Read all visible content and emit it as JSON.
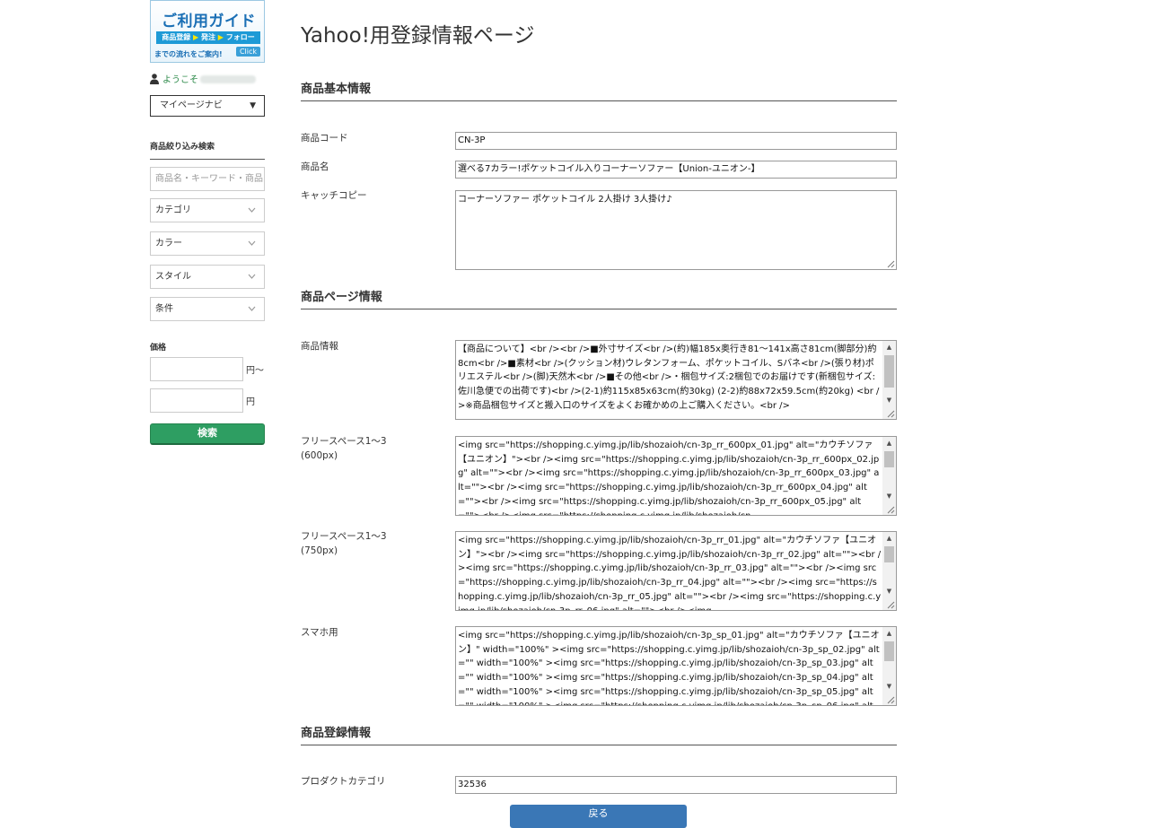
{
  "banner": {
    "title": "ご利用ガイド",
    "strip_a": "商品登録",
    "strip_b": "発注",
    "strip_c": "フォロー",
    "arrow": "▶",
    "foot": "までの流れをご案内!",
    "click": "Click"
  },
  "sidebar": {
    "welcome": "ようこそ",
    "navi_select": "マイページナビ",
    "filter_title": "商品絞り込み検索",
    "keyword_placeholder": "商品名・キーワード・商品",
    "selects": [
      "カテゴリ",
      "カラー",
      "スタイル",
      "条件"
    ],
    "price_label": "価格",
    "price_from_unit": "円〜",
    "price_to_unit": "円",
    "search_button": "検索"
  },
  "page": {
    "title": "Yahoo!用登録情報ページ"
  },
  "sections": {
    "basic": "商品基本情報",
    "page_info": "商品ページ情報",
    "registration": "商品登録情報"
  },
  "fields": {
    "code_label": "商品コード",
    "code_value": "CN-3P",
    "name_label": "商品名",
    "name_value": "選べる7カラー!ポケットコイル入りコーナーソファー【Union-ユニオン-】",
    "catch_label": "キャッチコピー",
    "catch_value": "コーナーソファー ポケットコイル 2人掛け 3人掛け♪",
    "info_label": "商品情報",
    "info_value": "【商品について】<br /><br />■外寸サイズ<br />(約)幅185x奥行き81〜141x高さ81cm(脚部分)約8cm<br />■素材<br />(クッション材)ウレタンフォーム、ポケットコイル、Sバネ<br />(張り材)ポリエステル<br />(脚)天然木<br />■その他<br />・梱包サイズ:2梱包でのお届けです(新梱包サイズ:佐川急便での出荷です)<br />(2-1)約115x85x63cm(約30kg) (2-2)約88x72x59.5cm(約20kg) <br />※商品梱包サイズと搬入口のサイズをよくお確かめの上ご購入ください。<br />",
    "free600_label_1": "フリースペース1〜3",
    "free600_label_2": "(600px)",
    "free600_value": "<img src=\"https://shopping.c.yimg.jp/lib/shozaioh/cn-3p_rr_600px_01.jpg\" alt=\"カウチソファ【ユニオン】\"><br /><img src=\"https://shopping.c.yimg.jp/lib/shozaioh/cn-3p_rr_600px_02.jpg\" alt=\"\"><br /><img src=\"https://shopping.c.yimg.jp/lib/shozaioh/cn-3p_rr_600px_03.jpg\" alt=\"\"><br /><img src=\"https://shopping.c.yimg.jp/lib/shozaioh/cn-3p_rr_600px_04.jpg\" alt=\"\"><br /><img src=\"https://shopping.c.yimg.jp/lib/shozaioh/cn-3p_rr_600px_05.jpg\" alt=\"\"><br /><img src=\"https://shopping.c.yimg.jp/lib/shozaioh/cn-",
    "free750_label_1": "フリースペース1〜3",
    "free750_label_2": "(750px)",
    "free750_value": "<img src=\"https://shopping.c.yimg.jp/lib/shozaioh/cn-3p_rr_01.jpg\" alt=\"カウチソファ【ユニオン】\"><br /><img src=\"https://shopping.c.yimg.jp/lib/shozaioh/cn-3p_rr_02.jpg\" alt=\"\"><br /><img src=\"https://shopping.c.yimg.jp/lib/shozaioh/cn-3p_rr_03.jpg\" alt=\"\"><br /><img src=\"https://shopping.c.yimg.jp/lib/shozaioh/cn-3p_rr_04.jpg\" alt=\"\"><br /><img src=\"https://shopping.c.yimg.jp/lib/shozaioh/cn-3p_rr_05.jpg\" alt=\"\"><br /><img src=\"https://shopping.c.yimg.jp/lib/shozaioh/cn-3p_rr_06.jpg\" alt=\"\"><br /><img",
    "sp_label": "スマホ用",
    "sp_value": "<img src=\"https://shopping.c.yimg.jp/lib/shozaioh/cn-3p_sp_01.jpg\" alt=\"カウチソファ【ユニオン】\" width=\"100%\" ><img src=\"https://shopping.c.yimg.jp/lib/shozaioh/cn-3p_sp_02.jpg\" alt=\"\" width=\"100%\" ><img src=\"https://shopping.c.yimg.jp/lib/shozaioh/cn-3p_sp_03.jpg\" alt=\"\" width=\"100%\" ><img src=\"https://shopping.c.yimg.jp/lib/shozaioh/cn-3p_sp_04.jpg\" alt=\"\" width=\"100%\" ><img src=\"https://shopping.c.yimg.jp/lib/shozaioh/cn-3p_sp_05.jpg\" alt=\"\" width=\"100%\" ><img src=\"https://shopping.c.yimg.jp/lib/shozaioh/cn-3p_sp_06.jpg\" alt=\"\"",
    "category_label": "プロダクトカテゴリ",
    "category_value": "32536"
  },
  "footer": {
    "back_button": "戻る"
  },
  "icons": {
    "user": "user-icon",
    "caret": "▼",
    "chevron": "chevron-down-icon",
    "scroll_up": "▲",
    "scroll_down": "▼"
  },
  "colors": {
    "accent_green": "#2e9e62",
    "accent_blue": "#3a77b6",
    "welcome_green": "#2d8a4a"
  }
}
